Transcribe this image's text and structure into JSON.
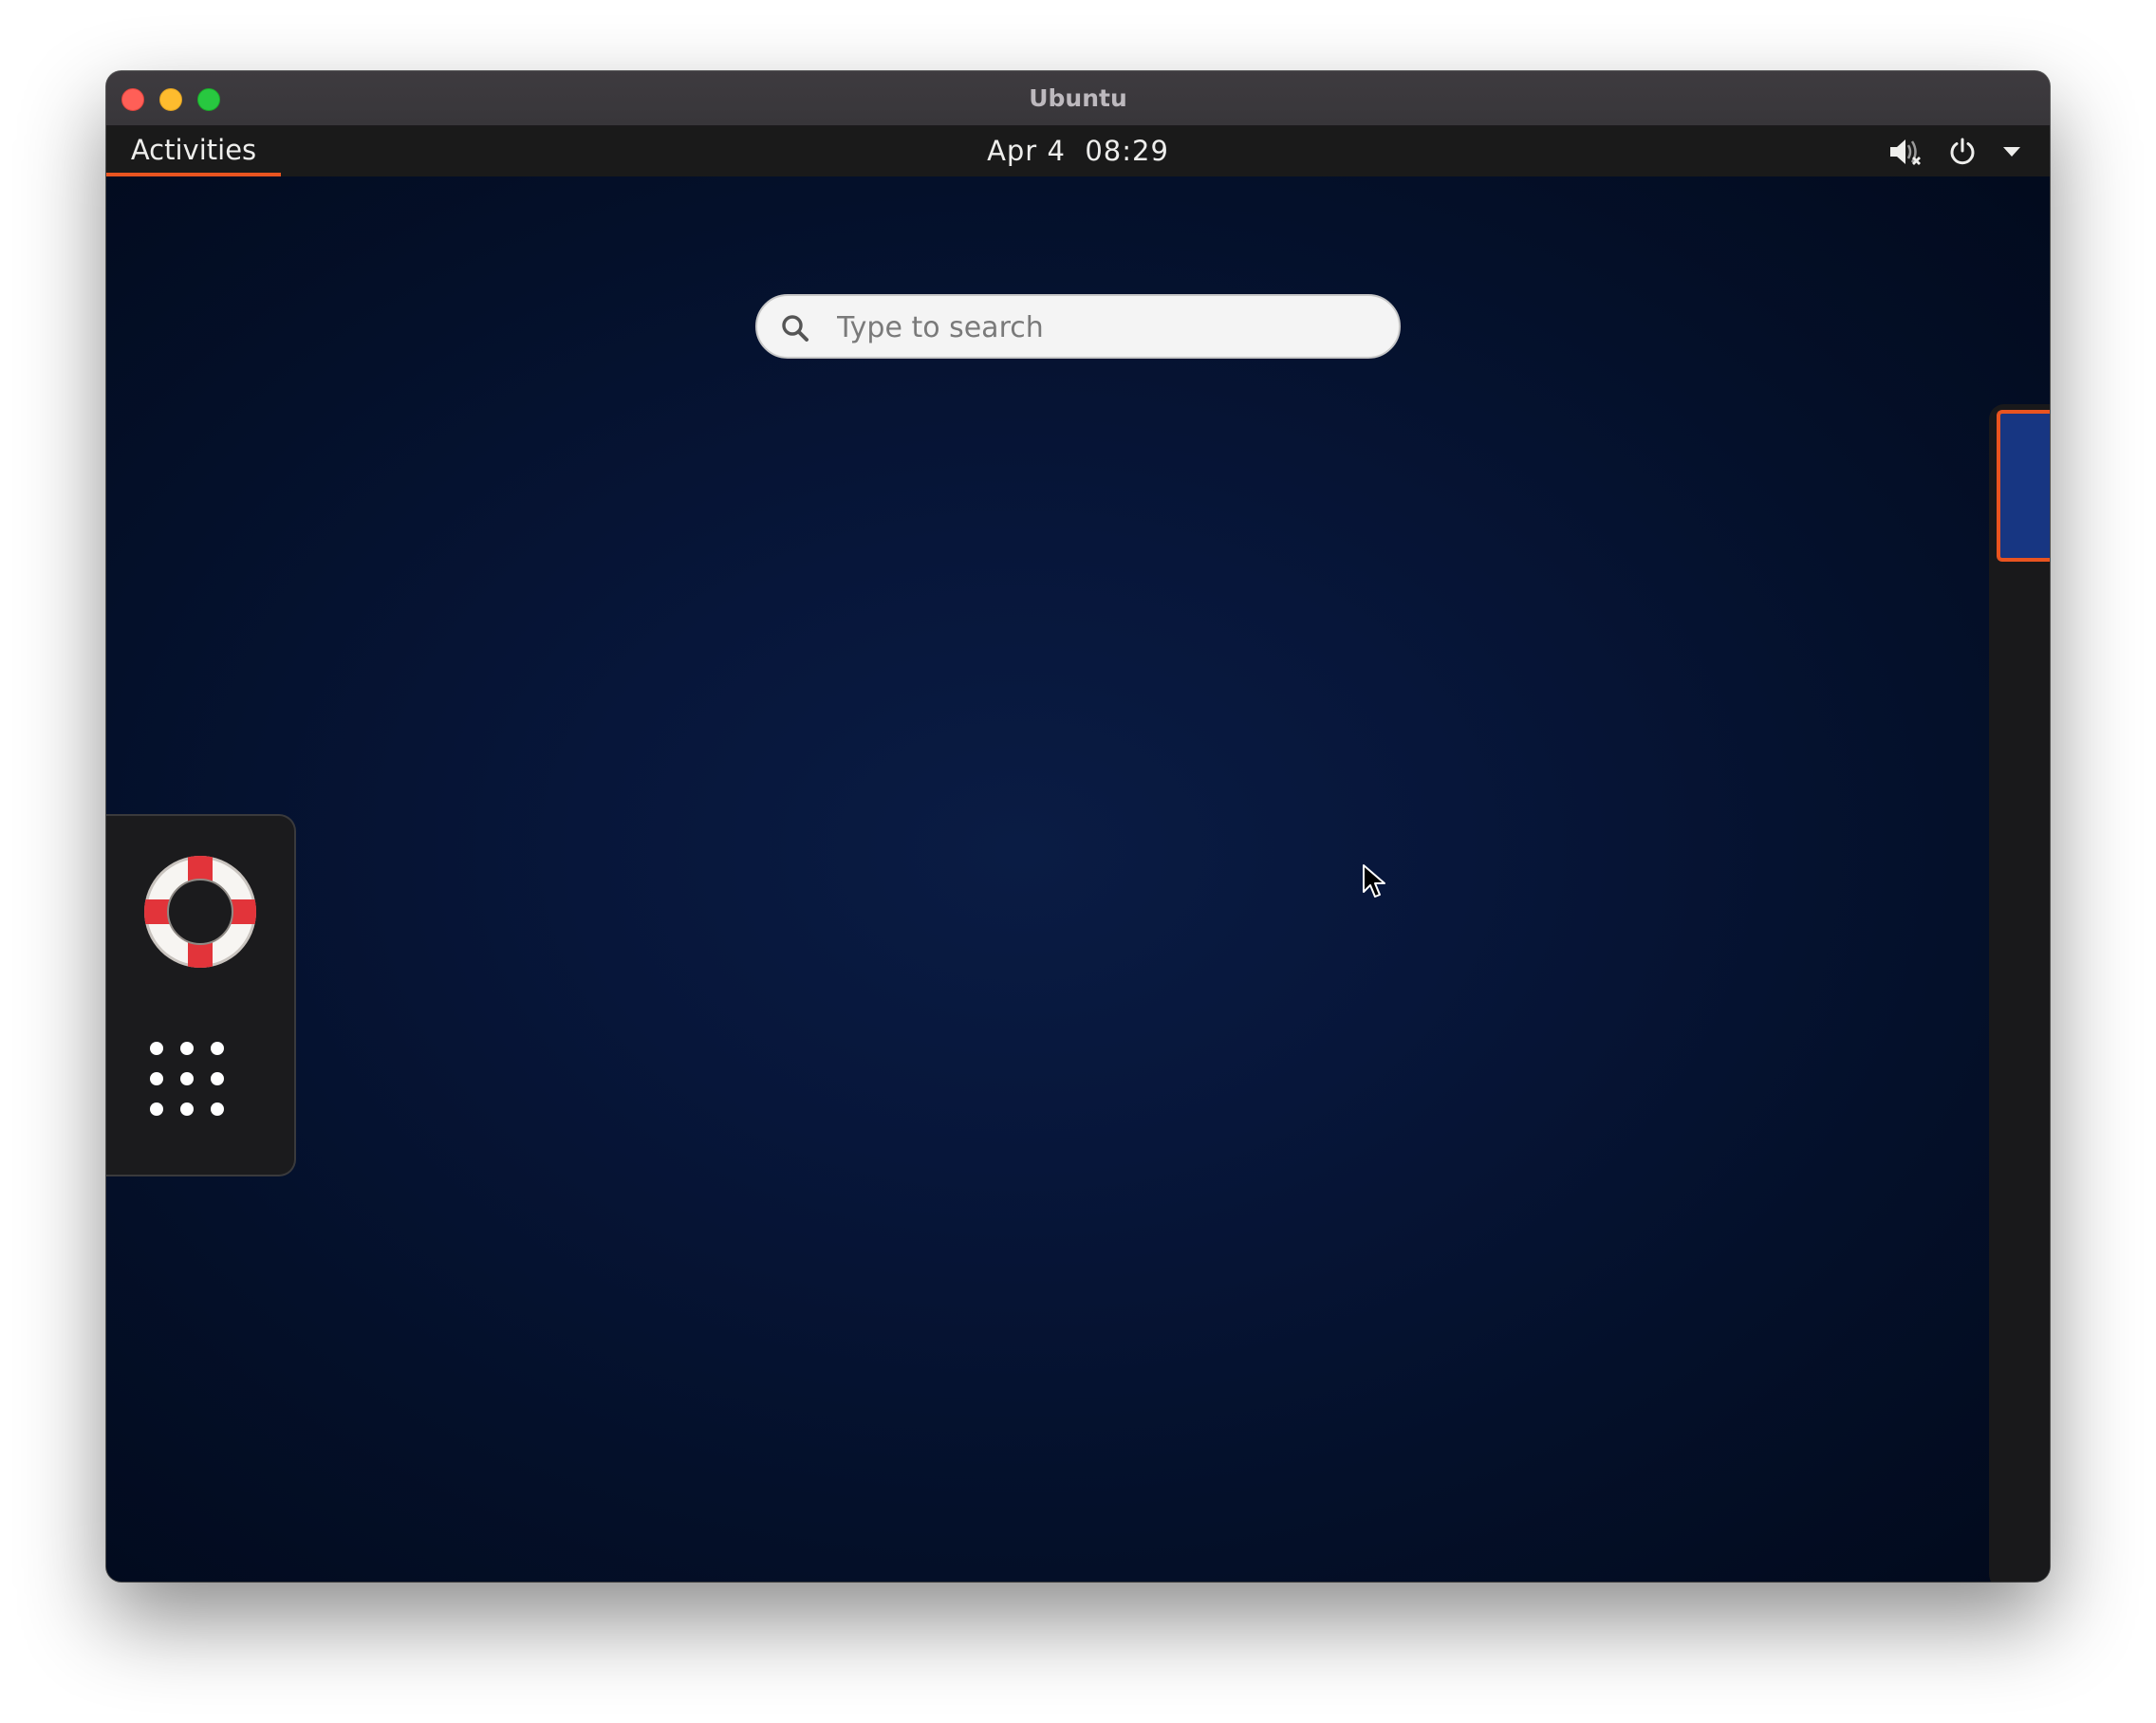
{
  "window": {
    "title": "Ubuntu",
    "controls": [
      "close",
      "minimize",
      "maximize"
    ]
  },
  "top_panel": {
    "activities_label": "Activities",
    "clock": "Apr 4  08:29",
    "tray_icons": [
      "audio-muted-icon",
      "power-icon",
      "dropdown-arrow-icon"
    ]
  },
  "search": {
    "placeholder": "Type to search",
    "value": ""
  },
  "dash": {
    "items": [
      {
        "name": "help",
        "icon": "lifebuoy-icon"
      },
      {
        "name": "show-applications",
        "icon": "app-grid-icon"
      }
    ]
  },
  "workspaces": {
    "count": 1,
    "active_index": 0
  },
  "colors": {
    "accent": "#e95420",
    "panel": "#1a1a1a",
    "desktop": "#07163a",
    "workspace_thumb": "#173682",
    "lifebuoy_red": "#e2343a"
  }
}
